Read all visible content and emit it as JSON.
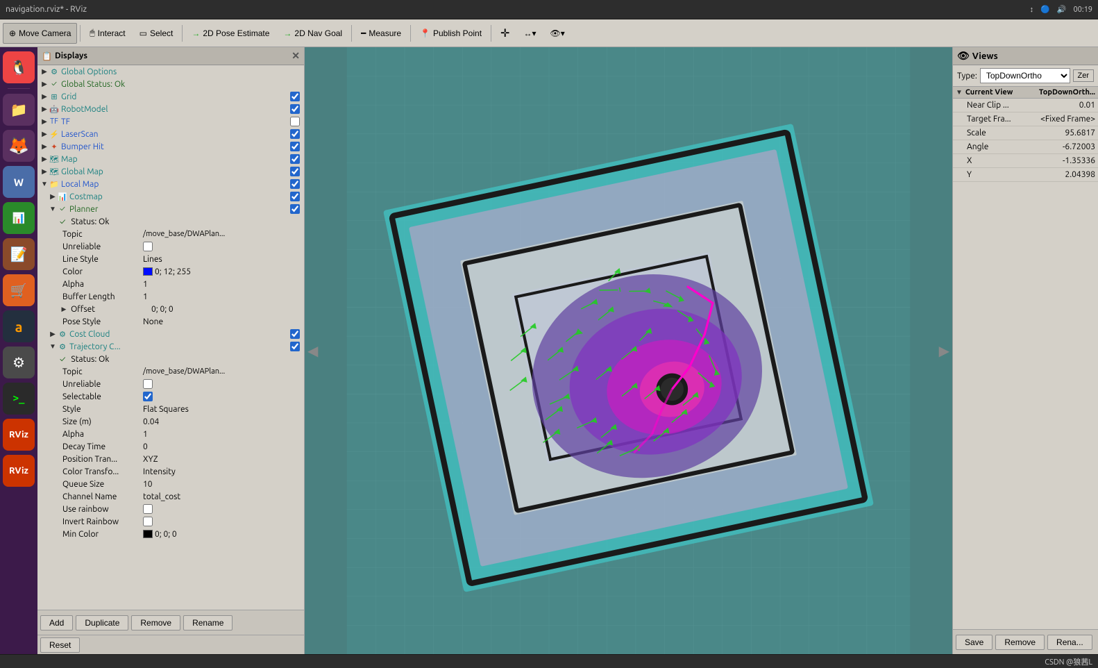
{
  "titlebar": {
    "title": "navigation.rviz* - RViz",
    "icons": [
      "↕",
      "P",
      "🔊"
    ],
    "time": "00:19"
  },
  "toolbar": {
    "buttons": [
      {
        "id": "move-camera",
        "label": "Move Camera",
        "icon": "⊕",
        "active": false
      },
      {
        "id": "interact",
        "label": "Interact",
        "icon": "🖱",
        "active": false
      },
      {
        "id": "select",
        "label": "Select",
        "icon": "▭",
        "active": false
      },
      {
        "id": "pose-estimate",
        "label": "2D Pose Estimate",
        "icon": "→",
        "active": false
      },
      {
        "id": "nav-goal",
        "label": "2D Nav Goal",
        "icon": "→",
        "active": false
      },
      {
        "id": "measure",
        "label": "Measure",
        "icon": "📏",
        "active": false
      },
      {
        "id": "publish-point",
        "label": "Publish Point",
        "icon": "📍",
        "active": false
      }
    ],
    "extra_icons": [
      "+",
      "↔",
      "👁"
    ]
  },
  "displays": {
    "panel_title": "Displays",
    "items": [
      {
        "id": "global-options",
        "label": "Global Options",
        "icon": "⚙",
        "color": "teal",
        "indent": 0,
        "has_arrow": true,
        "arrow_open": false,
        "checked": null
      },
      {
        "id": "global-status",
        "label": "Global Status: Ok",
        "icon": "✓",
        "color": "green",
        "indent": 0,
        "has_arrow": true,
        "arrow_open": false,
        "checked": null
      },
      {
        "id": "grid",
        "label": "Grid",
        "icon": "⊞",
        "color": "teal",
        "indent": 0,
        "has_arrow": true,
        "arrow_open": false,
        "checked": true
      },
      {
        "id": "robot-model",
        "label": "RobotModel",
        "icon": "🤖",
        "color": "teal",
        "indent": 0,
        "has_arrow": true,
        "arrow_open": false,
        "checked": true
      },
      {
        "id": "tf",
        "label": "TF",
        "icon": "🔗",
        "color": "blue",
        "indent": 0,
        "has_arrow": true,
        "arrow_open": false,
        "checked": false
      },
      {
        "id": "laser-scan",
        "label": "LaserScan",
        "icon": "⚡",
        "color": "blue",
        "indent": 0,
        "has_arrow": true,
        "arrow_open": false,
        "checked": true
      },
      {
        "id": "bumper-hit",
        "label": "Bumper Hit",
        "icon": "✦",
        "color": "blue",
        "indent": 0,
        "has_arrow": true,
        "arrow_open": false,
        "checked": true
      },
      {
        "id": "map",
        "label": "Map",
        "icon": "🗺",
        "color": "teal",
        "indent": 0,
        "has_arrow": true,
        "arrow_open": false,
        "checked": true
      },
      {
        "id": "global-map",
        "label": "Global Map",
        "icon": "🗺",
        "color": "teal",
        "indent": 0,
        "has_arrow": true,
        "arrow_open": false,
        "checked": true
      },
      {
        "id": "local-map",
        "label": "Local Map",
        "icon": "📁",
        "color": "blue",
        "indent": 0,
        "has_arrow": true,
        "arrow_open": true,
        "checked": true
      },
      {
        "id": "costmap",
        "label": "Costmap",
        "icon": "📊",
        "color": "teal",
        "indent": 1,
        "has_arrow": true,
        "arrow_open": false,
        "checked": true
      },
      {
        "id": "planner",
        "label": "Planner",
        "icon": "✓",
        "color": "green",
        "indent": 1,
        "has_arrow": true,
        "arrow_open": true,
        "checked": true
      }
    ],
    "planner_props": [
      {
        "name": "Status: Ok",
        "value": "",
        "icon": "✓",
        "is_status": true
      },
      {
        "name": "Topic",
        "value": "/move_base/DWAPlan...",
        "indent": 2
      },
      {
        "name": "Unreliable",
        "value": "",
        "checkbox": true,
        "checked": false,
        "indent": 2
      },
      {
        "name": "Line Style",
        "value": "Lines",
        "indent": 2
      },
      {
        "name": "Color",
        "value": "0; 12; 255",
        "color_swatch": "#000CFF",
        "indent": 2
      },
      {
        "name": "Alpha",
        "value": "1",
        "indent": 2
      },
      {
        "name": "Buffer Length",
        "value": "1",
        "indent": 2
      },
      {
        "name": "Offset",
        "value": "0; 0; 0",
        "indent": 2,
        "has_arrow": true
      },
      {
        "name": "Pose Style",
        "value": "None",
        "indent": 2
      }
    ],
    "cost_cloud": {
      "id": "cost-cloud",
      "label": "Cost Cloud",
      "icon": "⚙",
      "color": "teal",
      "indent": 1,
      "has_arrow": true,
      "checked": true
    },
    "trajectory": {
      "id": "trajectory-c",
      "label": "Trajectory C...",
      "icon": "⚙",
      "color": "teal",
      "indent": 1,
      "has_arrow": true,
      "arrow_open": true,
      "checked": true,
      "props": [
        {
          "name": "Status: Ok",
          "value": "",
          "icon": "✓",
          "is_status": true
        },
        {
          "name": "Topic",
          "value": "/move_base/DWAPlan...",
          "indent": 2
        },
        {
          "name": "Unreliable",
          "value": "",
          "checkbox": true,
          "checked": false,
          "indent": 2
        },
        {
          "name": "Selectable",
          "value": "",
          "checkbox": true,
          "checked": true,
          "indent": 2
        },
        {
          "name": "Style",
          "value": "Flat Squares",
          "indent": 2
        },
        {
          "name": "Size (m)",
          "value": "0.04",
          "indent": 2
        },
        {
          "name": "Alpha",
          "value": "1",
          "indent": 2
        },
        {
          "name": "Decay Time",
          "value": "0",
          "indent": 2
        },
        {
          "name": "Position Tran...",
          "value": "XYZ",
          "indent": 2
        },
        {
          "name": "Color Transfo...",
          "value": "Intensity",
          "indent": 2
        },
        {
          "name": "Queue Size",
          "value": "10",
          "indent": 2
        },
        {
          "name": "Channel Name",
          "value": "total_cost",
          "indent": 2
        },
        {
          "name": "Use rainbow",
          "value": "",
          "checkbox": true,
          "checked": false,
          "indent": 2
        },
        {
          "name": "Invert Rainbow",
          "value": "",
          "checkbox": true,
          "checked": false,
          "indent": 2
        },
        {
          "name": "Min Color",
          "value": "0; 0; 0",
          "color_swatch": "#000000",
          "indent": 2
        }
      ]
    },
    "buttons": [
      "Add",
      "Duplicate",
      "Remove",
      "Rename"
    ],
    "reset_label": "Reset"
  },
  "views": {
    "panel_title": "Views",
    "type_label": "Type:",
    "type_value": "TopDownOrtho",
    "zero_btn": "Zer",
    "current_view_label": "Current View",
    "current_view_type": "TopDownOrth...",
    "props": [
      {
        "name": "Near Clip ...",
        "value": "0.01"
      },
      {
        "name": "Target Fra...",
        "value": "<Fixed Frame>"
      },
      {
        "name": "Scale",
        "value": "95.6817"
      },
      {
        "name": "Angle",
        "value": "-6.72003"
      },
      {
        "name": "X",
        "value": "-1.35336"
      },
      {
        "name": "Y",
        "value": "2.04398"
      }
    ],
    "buttons": [
      "Save",
      "Remove",
      "Rena..."
    ]
  },
  "statusbar": {
    "text": "CSDN @狼茜L"
  },
  "launcher": {
    "items": [
      {
        "icon": "🐧",
        "id": "ubuntu"
      },
      {
        "icon": "📁",
        "id": "files"
      },
      {
        "icon": "🔥",
        "id": "firefox"
      },
      {
        "icon": "📄",
        "id": "office"
      },
      {
        "icon": "📊",
        "id": "calc"
      },
      {
        "icon": "📝",
        "id": "text"
      },
      {
        "icon": "🛒",
        "id": "store"
      },
      {
        "icon": "A",
        "id": "amazon"
      },
      {
        "icon": "⚙",
        "id": "settings"
      },
      {
        "icon": ">_",
        "id": "terminal"
      },
      {
        "icon": "R",
        "id": "rviz1"
      },
      {
        "icon": "R",
        "id": "rviz2"
      }
    ]
  }
}
